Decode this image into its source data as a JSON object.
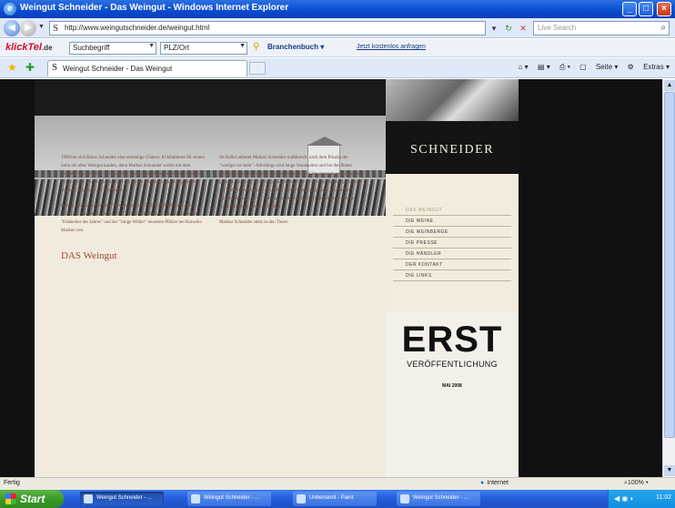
{
  "window": {
    "title": "Weingut Schneider - Das Weingut - Windows Internet Explorer"
  },
  "browser": {
    "address": "http://www.weingutschneider.de/weingut.html",
    "search_placeholder": "Live Search",
    "toolbar": {
      "brand": "klickTel",
      "brand_suffix": ".de",
      "select_one": "Suchbegriff",
      "select_two": "PLZ/Ort",
      "branch_label": "Branchenbuch",
      "link_text": "Jetzt kostenlos anfragen"
    },
    "tab_title": "Weingut Schneider - Das Weingut",
    "commands": [
      "Seite",
      "Extras"
    ]
  },
  "site": {
    "logo": "SCHNEIDER",
    "heading": "DAS Weingut",
    "menu": [
      {
        "label": "DAS WEINGUT",
        "active": true
      },
      {
        "label": "DIE WEINE",
        "active": false
      },
      {
        "label": "DIE WEINBERGE",
        "active": false
      },
      {
        "label": "DIE PRESSE",
        "active": false
      },
      {
        "label": "DIE HÄNDLER",
        "active": false
      },
      {
        "label": "DER KONTAKT",
        "active": false
      },
      {
        "label": "DIE LINKS",
        "active": false
      }
    ],
    "promo": {
      "title": "ERST",
      "subtitle": "VERÖFFENTLICHUNG",
      "date": "MAI 2008"
    },
    "col_left": [
      "1990 bot sich Klaus Schneider eine einmalige Chance: Er kümmerte für seinen Sohn ein altes Weingut kaufen, denn Markus Schneider wollte mit dem wenden. Winzer! 1991-1994 lernte er das Handwerk bei Dr. Bürklin-Wolf in Wachenheim und bearbeiten 1994 den ersten Jahrgang vom neugegründeten Weingut Schneider auf den Markt.",
      "Bereits 2003 wurde er zum \"Newcomer\" vom FEINSCHMECKER gekürt. 2008 lässt der GAULT MILLAU - Wein Guide Markus Schneider als einen \"Entdecker des Jahres\" und der \"Junge Wilder\" neuesten Pfälzer bei Rotwein-Markus von"
    ],
    "col_right": [
      "Im Keller arbeitet Markus Schneider traditionell, nach dem Prinzip der \"weniger ist mehr\". Allerdings wird lange Standzeiten und bei den Roten selbstgewogen. Dafür muss die Verarbeitung der Güte gepresst sein, ganz nur gesamte Trauben, bei niedrigen Erträgen. Dazu wird schonend abgepresst und der Wein ohne Eingriffe von außen zu Höchstem ausgebaut. Die Weißen bleiben bis kurz vor der Füllung auf der Feinhefe, um die Struktur und die Aromenbildung weiter zu fördern.",
      "Markus Schneider steht zu den Tieren"
    ]
  },
  "statusbar": {
    "left": "Fertig",
    "zone": "Internet",
    "zoom": "100%"
  },
  "taskbar": {
    "start": "Start",
    "buttons": [
      {
        "label": "Weingut Schneider - ...",
        "active": true
      },
      {
        "label": "Weingut Schneider - ...",
        "active": false
      },
      {
        "label": "Unbenannt - Paint",
        "active": false
      },
      {
        "label": "Weingut Schneider - ...",
        "active": false
      }
    ],
    "clock": "11:02"
  }
}
